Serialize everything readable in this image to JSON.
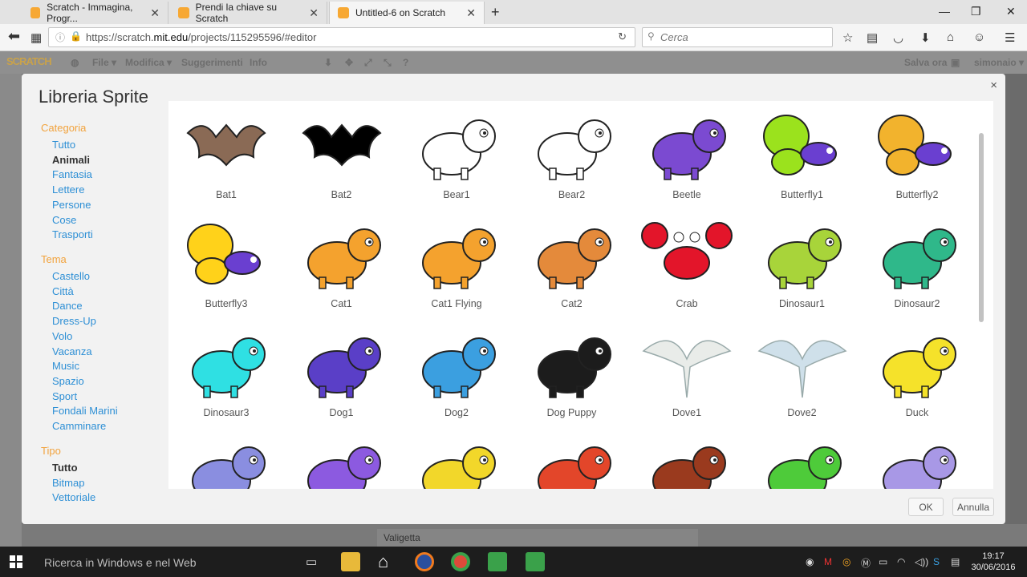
{
  "browser": {
    "tabs": [
      {
        "title": "Scratch - Immagina, Progr..."
      },
      {
        "title": "Prendi la chiave su Scratch"
      },
      {
        "title": "Untitled-6 on Scratch"
      }
    ],
    "url_prefix": "https://scratch.",
    "url_domain": "mit.edu",
    "url_suffix": "/projects/115295596/#editor",
    "search_placeholder": "Cerca"
  },
  "scratch_menu": {
    "logo": "SCRATCH",
    "items": [
      "File ▾",
      "Modifica ▾",
      "Suggerimenti",
      "Info"
    ],
    "save_now": "Salva ora",
    "user": "simonaio ▾"
  },
  "modal": {
    "title": "Libreria Sprite",
    "close": "×",
    "ok_label": "OK",
    "cancel_label": "Annulla"
  },
  "sidebar": {
    "category_heading": "Categoria",
    "categories": [
      "Tutto",
      "Animali",
      "Fantasia",
      "Lettere",
      "Persone",
      "Cose",
      "Trasporti"
    ],
    "theme_heading": "Tema",
    "themes": [
      "Castello",
      "Città",
      "Dance",
      "Dress-Up",
      "Volo",
      "Vacanza",
      "Music",
      "Spazio",
      "Sport",
      "Fondali Marini",
      "Camminare"
    ],
    "type_heading": "Tipo",
    "types": [
      "Tutto",
      "Bitmap",
      "Vettoriale"
    ],
    "selected_category": "Animali",
    "selected_type": "Tutto"
  },
  "sprites": [
    {
      "name": "Bat1",
      "icon": "bat-brown-icon",
      "color": "#8a6a55"
    },
    {
      "name": "Bat2",
      "icon": "bat-black-icon",
      "color": "#000000"
    },
    {
      "name": "Bear1",
      "icon": "polar-bear-scarf-icon",
      "color": "#ffffff"
    },
    {
      "name": "Bear2",
      "icon": "polar-bear-outline-icon",
      "color": "#ffffff"
    },
    {
      "name": "Beetle",
      "icon": "beetle-icon",
      "color": "#7b4ad1"
    },
    {
      "name": "Butterfly1",
      "icon": "butterfly-green-icon",
      "color": "#9be21d"
    },
    {
      "name": "Butterfly2",
      "icon": "butterfly-red-icon",
      "color": "#f2b32d"
    },
    {
      "name": "Butterfly3",
      "icon": "butterfly-purple-icon",
      "color": "#ffd21a"
    },
    {
      "name": "Cat1",
      "icon": "cat-icon",
      "color": "#f4a22e"
    },
    {
      "name": "Cat1 Flying",
      "icon": "cat-flying-icon",
      "color": "#f4a22e"
    },
    {
      "name": "Cat2",
      "icon": "cat-lying-icon",
      "color": "#e48a3b"
    },
    {
      "name": "Crab",
      "icon": "crab-icon",
      "color": "#e3152a"
    },
    {
      "name": "Dinosaur1",
      "icon": "dinosaur-light-green-icon",
      "color": "#a8d43a"
    },
    {
      "name": "Dinosaur2",
      "icon": "dinosaur-teal-icon",
      "color": "#2fb88a"
    },
    {
      "name": "Dinosaur3",
      "icon": "dinosaur-cyan-icon",
      "color": "#2fe0e3"
    },
    {
      "name": "Dog1",
      "icon": "dog-white-icon",
      "color": "#5a3fc7"
    },
    {
      "name": "Dog2",
      "icon": "dog-blue-icon",
      "color": "#3b9fe0"
    },
    {
      "name": "Dog Puppy",
      "icon": "black-puppy-icon",
      "color": "#1c1c1c"
    },
    {
      "name": "Dove1",
      "icon": "dove-icon",
      "color": "#e9ece9"
    },
    {
      "name": "Dove2",
      "icon": "dove-flying-icon",
      "color": "#cfe0ea"
    },
    {
      "name": "Duck",
      "icon": "duck-icon",
      "color": "#f5e22a"
    },
    {
      "name": "",
      "icon": "elephant-icon",
      "color": "#8a8ee0"
    },
    {
      "name": "",
      "icon": "fish-purple-icon",
      "color": "#8c5ae0"
    },
    {
      "name": "",
      "icon": "fish-yellow-icon",
      "color": "#f2d72a"
    },
    {
      "name": "",
      "icon": "fox-dots-icon",
      "color": "#e3462a"
    },
    {
      "name": "",
      "icon": "fox-brown-icon",
      "color": "#9a3a1e"
    },
    {
      "name": "",
      "icon": "frog-icon",
      "color": "#4ecb3a"
    },
    {
      "name": "",
      "icon": "bug-purple-icon",
      "color": "#a898e6"
    }
  ],
  "taskbar": {
    "search": "Ricerca in Windows e nel Web",
    "time": "19:17",
    "date": "30/06/2016"
  }
}
